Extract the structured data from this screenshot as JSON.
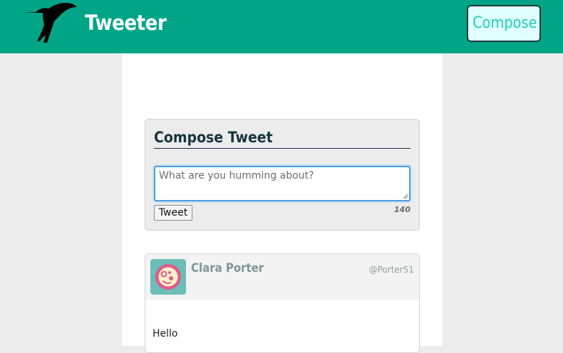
{
  "header": {
    "brand": "Tweeter",
    "compose_label": "Compose",
    "logo_icon": "hummingbird-icon",
    "background_color": "#00a587"
  },
  "compose": {
    "title": "Compose Tweet",
    "placeholder": "What are you humming about?",
    "value": "",
    "submit_label": "Tweet",
    "counter": "140"
  },
  "tweets": [
    {
      "name": "Clara Porter",
      "handle": "@Porter51",
      "avatar_icon": "avatar-icon",
      "content": "Hello"
    }
  ]
}
